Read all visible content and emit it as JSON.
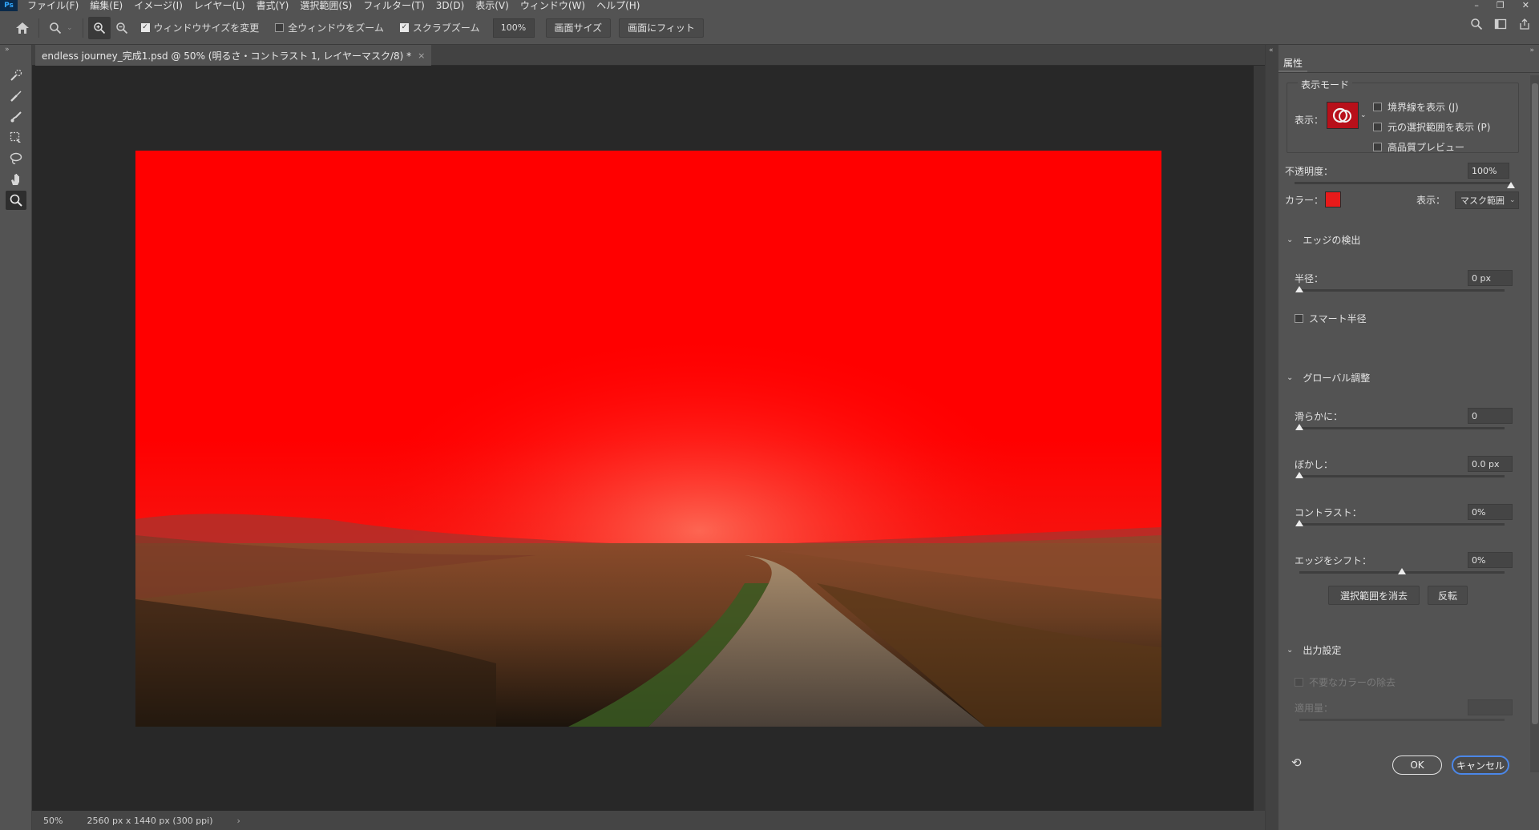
{
  "menubar": {
    "app_badge": "Ps",
    "items": [
      "ファイル(F)",
      "編集(E)",
      "イメージ(I)",
      "レイヤー(L)",
      "書式(Y)",
      "選択範囲(S)",
      "フィルター(T)",
      "3D(D)",
      "表示(V)",
      "ウィンドウ(W)",
      "ヘルプ(H)"
    ]
  },
  "options": {
    "resize_windows": "ウィンドウサイズを変更",
    "resize_windows_checked": true,
    "zoom_all": "全ウィンドウをズーム",
    "zoom_all_checked": false,
    "scrubby_zoom": "スクラブズーム",
    "scrubby_zoom_checked": true,
    "zoom_value": "100%",
    "fit_screen": "画面サイズ",
    "fill_screen": "画面にフィット"
  },
  "document": {
    "tab_title": "endless journey_完成1.psd @ 50% (明るさ・コントラスト 1, レイヤーマスク/8) *",
    "tab_close": "×",
    "mask_color": "#ff0000"
  },
  "status": {
    "zoom": "50%",
    "dims": "2560 px x 1440 px (300 ppi)",
    "arrow": "›"
  },
  "properties": {
    "tab": "属性",
    "view_mode": {
      "title": "表示モード",
      "label": "表示：",
      "show_edges": "境界線を表示 (J)",
      "show_original": "元の選択範囲を表示 (P)",
      "hq_preview": "高品質プレビュー"
    },
    "opacity_label": "不透明度：",
    "opacity_value": "100%",
    "opacity_fraction": 1.0,
    "color_label": "カラー：",
    "color_swatch": "#e81a1a",
    "display_label": "表示：",
    "display_value": "マスク範囲",
    "edge_detection": {
      "title": "エッジの検出",
      "radius_label": "半径：",
      "radius_value": "0 px",
      "radius_fraction": 0.0,
      "smart_radius": "スマート半径"
    },
    "global": {
      "title": "グローバル調整",
      "smooth_label": "滑らかに：",
      "smooth_value": "0",
      "smooth_fraction": 0.0,
      "feather_label": "ぼかし：",
      "feather_value": "0.0 px",
      "feather_fraction": 0.0,
      "contrast_label": "コントラスト：",
      "contrast_value": "0%",
      "contrast_fraction": 0.0,
      "shift_label": "エッジをシフト：",
      "shift_value": "0%",
      "shift_fraction": 0.5,
      "clear_selection": "選択範囲を消去",
      "invert": "反転"
    },
    "output": {
      "title": "出力設定",
      "decontaminate": "不要なカラーの除去",
      "amount_label": "適用量："
    },
    "ok": "OK",
    "cancel": "キャンセル"
  }
}
